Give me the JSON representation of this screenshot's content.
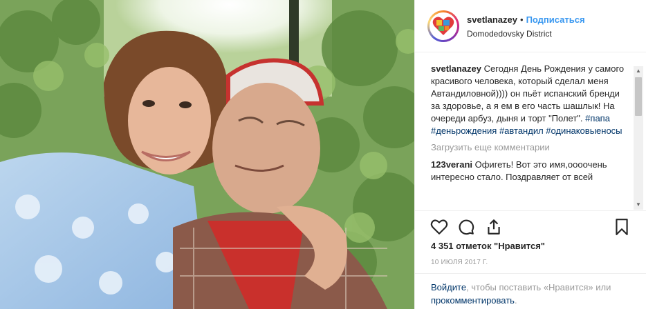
{
  "post": {
    "username": "svetlanazey",
    "separator": "•",
    "follow_label": "Подписаться",
    "location": "Domodedovsky District",
    "caption_user": "svetlanazey",
    "caption_text": "Сегодня День Рождения у самого красивого человека, который сделал меня Автандиловной)))) он пьёт испанский бренди за здоровье, а я ем в его часть шашлык! На очереди арбуз, дыня и торт \"Полет\".",
    "hashtags": [
      "#папа",
      "#деньрождения",
      "#автандил",
      "#одинаковыеносы"
    ],
    "load_more": "Загрузить еще комментарии",
    "comment2_user": "123verani",
    "comment2_text": "Офигеть! Вот это имя,оооочень интересно стало. Поздравляет от всей",
    "likes": "4 351 отметок \"Нравится\"",
    "date": "10 ИЮЛЯ 2017 Г.",
    "login_link1": "Войдите",
    "login_text1": ", чтобы поставить «Нравится»",
    "login_or": "или",
    "login_link2": "прокомментировать",
    "login_end": "."
  },
  "icons": [
    "heart-icon",
    "comment-icon",
    "share-icon",
    "bookmark-icon"
  ],
  "colors": {
    "link": "#3897f0",
    "hashtag": "#003569",
    "muted": "#999999"
  }
}
